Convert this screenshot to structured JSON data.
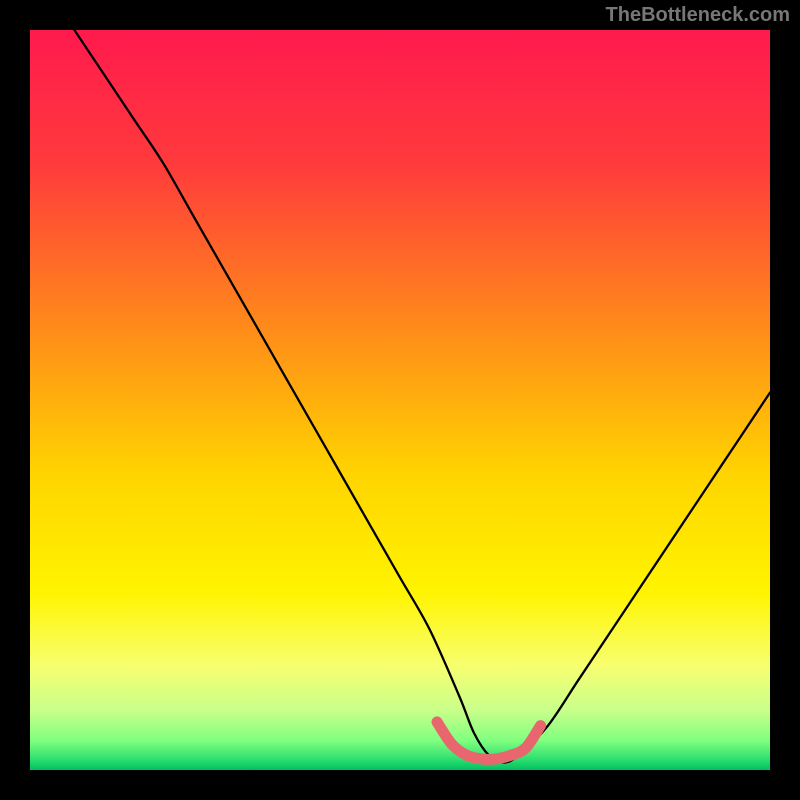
{
  "attribution": "TheBottleneck.com",
  "chart_data": {
    "type": "line",
    "title": "",
    "xlabel": "",
    "ylabel": "",
    "xlim": [
      0,
      100
    ],
    "ylim": [
      0,
      100
    ],
    "background_gradient_stops": [
      {
        "offset": 0.0,
        "color": "#ff1a4d"
      },
      {
        "offset": 0.18,
        "color": "#ff3a3c"
      },
      {
        "offset": 0.4,
        "color": "#ff8a1a"
      },
      {
        "offset": 0.6,
        "color": "#ffd400"
      },
      {
        "offset": 0.76,
        "color": "#fff400"
      },
      {
        "offset": 0.86,
        "color": "#f7ff70"
      },
      {
        "offset": 0.92,
        "color": "#c8ff8a"
      },
      {
        "offset": 0.96,
        "color": "#80ff80"
      },
      {
        "offset": 0.985,
        "color": "#30e070"
      },
      {
        "offset": 1.0,
        "color": "#00c060"
      }
    ],
    "series": [
      {
        "name": "bottleneck-curve",
        "x": [
          6,
          10,
          14,
          18,
          22,
          26,
          30,
          34,
          38,
          42,
          46,
          50,
          54,
          58,
          60,
          62,
          64,
          66,
          70,
          74,
          78,
          82,
          86,
          90,
          94,
          98,
          100
        ],
        "y": [
          100,
          94,
          88,
          82,
          75,
          68,
          61,
          54,
          47,
          40,
          33,
          26,
          19,
          10,
          5,
          2,
          1,
          2,
          6,
          12,
          18,
          24,
          30,
          36,
          42,
          48,
          51
        ]
      }
    ],
    "highlight_range": {
      "name": "optimal-zone",
      "x": [
        55,
        57,
        59,
        61,
        63,
        65,
        67,
        69
      ],
      "y": [
        6.5,
        3.5,
        2.0,
        1.5,
        1.5,
        2.0,
        3.0,
        6.0
      ]
    }
  }
}
